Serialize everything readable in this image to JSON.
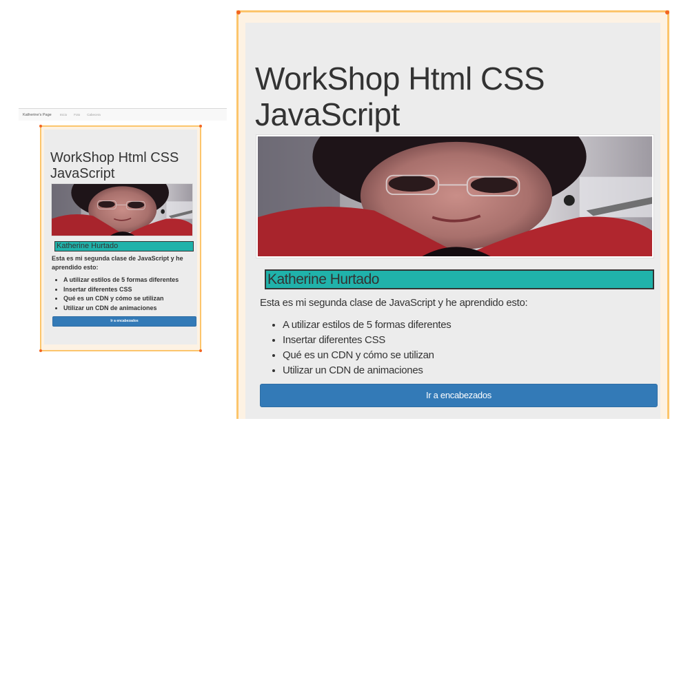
{
  "navbar": {
    "brand": "Katherine's Page",
    "links": [
      "Inicio",
      "Foto",
      "Cabecera"
    ]
  },
  "page": {
    "title_line1": "WorkShop Html CSS",
    "title_line2": "JavaScript",
    "photo_alt": "Katherine Hurtado",
    "name": "Katherine Hurtado",
    "intro": "Esta es mi segunda clase de JavaScript y he aprendido esto:",
    "items": [
      "A utilizar estilos de 5 formas diferentes",
      "Insertar diferentes CSS",
      "Qué es un CDN y cómo se utilizan",
      "Utilizar un CDN de animaciones"
    ],
    "button_label": "Ir a encabezados"
  },
  "colors": {
    "card_border": "#fcc56b",
    "corner_handle": "#f26522",
    "jumbotron_bg": "#ececec",
    "name_bg": "#20b2aa",
    "button_bg": "#337ab7"
  }
}
